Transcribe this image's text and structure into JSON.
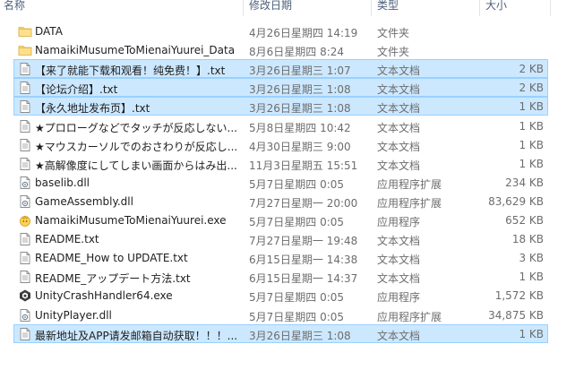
{
  "columns": {
    "name": "名称",
    "date": "修改日期",
    "type": "类型",
    "size": "大小"
  },
  "files": [
    {
      "name": "DATA",
      "date": "4月26日星期四 14:19",
      "type": "文件夹",
      "size": "",
      "icon": "folder-icon",
      "selected": false
    },
    {
      "name": "NamaikiMusumeToMienaiYuurei_Data",
      "date": "8月6日星期四 8:24",
      "type": "文件夹",
      "size": "",
      "icon": "folder-icon",
      "selected": false
    },
    {
      "name": "【来了就能下载和观看！纯免费！】.txt",
      "date": "3月26日星期三 1:07",
      "type": "文本文档",
      "size": "2 KB",
      "icon": "text-file-icon",
      "selected": true
    },
    {
      "name": "【论坛介绍】.txt",
      "date": "3月26日星期三 1:08",
      "type": "文本文档",
      "size": "2 KB",
      "icon": "text-file-icon",
      "selected": true
    },
    {
      "name": "【永久地址发布页】.txt",
      "date": "3月26日星期三 1:08",
      "type": "文本文档",
      "size": "1 KB",
      "icon": "text-file-icon",
      "selected": true
    },
    {
      "name": "★プロローグなどでタッチが反応しない...",
      "date": "5月8日星期四 10:42",
      "type": "文本文档",
      "size": "1 KB",
      "icon": "text-file-icon",
      "selected": false
    },
    {
      "name": "★マウスカーソルでのおさわりが反応し...",
      "date": "4月30日星期三 9:00",
      "type": "文本文档",
      "size": "1 KB",
      "icon": "text-file-icon",
      "selected": false
    },
    {
      "name": "★高解像度にしてしまい画面からはみ出...",
      "date": "11月3日星期五 15:51",
      "type": "文本文档",
      "size": "1 KB",
      "icon": "text-file-icon",
      "selected": false
    },
    {
      "name": "baselib.dll",
      "date": "5月7日星期四 0:05",
      "type": "应用程序扩展",
      "size": "234 KB",
      "icon": "dll-file-icon",
      "selected": false
    },
    {
      "name": "GameAssembly.dll",
      "date": "7月27日星期一 20:00",
      "type": "应用程序扩展",
      "size": "83,629 KB",
      "icon": "dll-file-icon",
      "selected": false
    },
    {
      "name": "NamaikiMusumeToMienaiYuurei.exe",
      "date": "5月7日星期四 0:05",
      "type": "应用程序",
      "size": "652 KB",
      "icon": "app-exe-icon",
      "selected": false
    },
    {
      "name": "README.txt",
      "date": "7月27日星期一 19:48",
      "type": "文本文档",
      "size": "18 KB",
      "icon": "text-file-icon",
      "selected": false
    },
    {
      "name": "README_How to UPDATE.txt",
      "date": "6月15日星期一 14:38",
      "type": "文本文档",
      "size": "3 KB",
      "icon": "text-file-icon",
      "selected": false
    },
    {
      "name": "README_アップデート方法.txt",
      "date": "6月15日星期一 14:37",
      "type": "文本文档",
      "size": "1 KB",
      "icon": "text-file-icon",
      "selected": false
    },
    {
      "name": "UnityCrashHandler64.exe",
      "date": "5月7日星期四 0:05",
      "type": "应用程序",
      "size": "1,572 KB",
      "icon": "unity-exe-icon",
      "selected": false
    },
    {
      "name": "UnityPlayer.dll",
      "date": "5月7日星期四 0:05",
      "type": "应用程序扩展",
      "size": "34,875 KB",
      "icon": "dll-file-icon",
      "selected": false
    },
    {
      "name": "最新地址及APP请发邮箱自动获取！！！...",
      "date": "3月26日星期三 1:08",
      "type": "文本文档",
      "size": "1 KB",
      "icon": "text-file-icon",
      "selected": true
    }
  ],
  "colors": {
    "selection_bg": "#cce8ff",
    "selection_border": "#99d1ff",
    "folder": "#f8d775",
    "header_text": "#4c607a"
  }
}
